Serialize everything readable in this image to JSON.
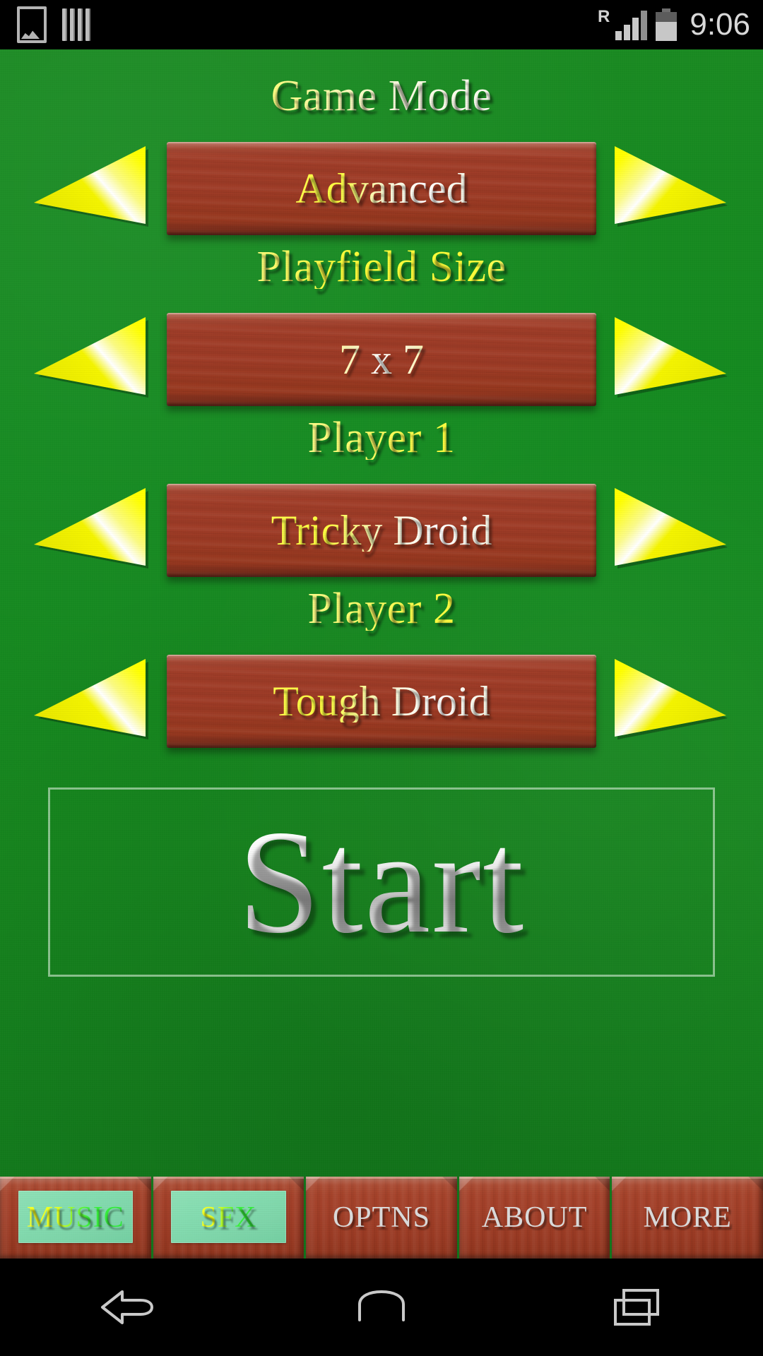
{
  "status_bar": {
    "icons_left": [
      "gallery-icon",
      "bars-icon"
    ],
    "roaming": "R",
    "signal_icon": "signal-bars-icon",
    "battery_icon": "battery-icon",
    "time": "9:06"
  },
  "colors": {
    "felt_green": "#158a21",
    "wood_red": "#9e3b26",
    "arrow_yellow": "#f5f500",
    "label_yellow": "#fdfd3a",
    "label_white": "#ffffff",
    "active_tab_green": "#84dcb0",
    "start_silver": "#d8d8d8",
    "status_bar_black": "#000000"
  },
  "settings": [
    {
      "label": "Game Mode",
      "value": "Advanced",
      "prev_icon": "left-arrow-icon",
      "next_icon": "right-arrow-icon"
    },
    {
      "label": "Playfield Size",
      "value": "7 x 7",
      "prev_icon": "left-arrow-icon",
      "next_icon": "right-arrow-icon"
    },
    {
      "label": "Player 1",
      "value": "Tricky Droid",
      "prev_icon": "left-arrow-icon",
      "next_icon": "right-arrow-icon"
    },
    {
      "label": "Player 2",
      "value": "Tough Droid",
      "prev_icon": "left-arrow-icon",
      "next_icon": "right-arrow-icon"
    }
  ],
  "start_button": {
    "label": "Start"
  },
  "toolbar": {
    "buttons": [
      {
        "label": "MUSIC",
        "active": true
      },
      {
        "label": "SFX",
        "active": true
      },
      {
        "label": "OPTNS",
        "active": false
      },
      {
        "label": "ABOUT",
        "active": false
      },
      {
        "label": "MORE",
        "active": false
      }
    ]
  },
  "navigation_bar": {
    "back": "back-icon",
    "home": "home-icon",
    "recents": "recents-icon"
  }
}
